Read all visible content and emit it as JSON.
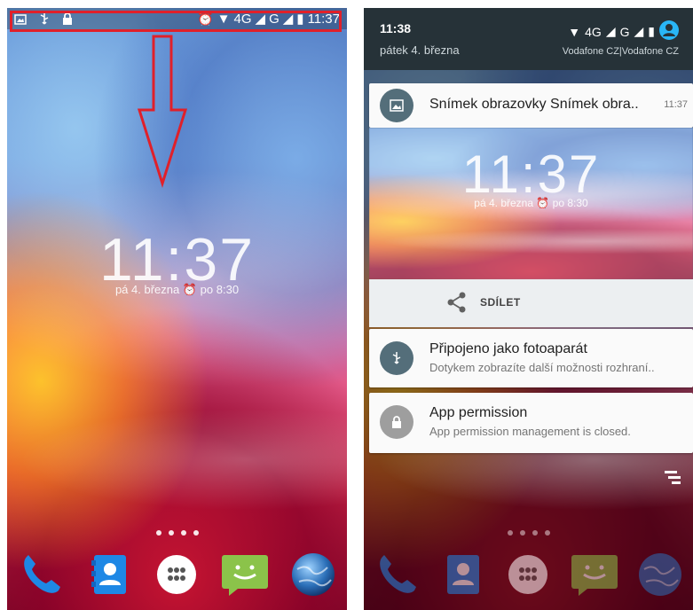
{
  "left": {
    "statusbar": {
      "time": "11:37",
      "network_1": "4G",
      "network_2": "G"
    },
    "lockscreen": {
      "clock": "11:37",
      "date": "pá 4. března",
      "alarm": "po 8:30"
    },
    "dock": [
      "phone-icon",
      "contacts-icon",
      "apps-icon",
      "messages-icon",
      "browser-icon"
    ]
  },
  "right": {
    "shade": {
      "time": "11:38",
      "date": "pátek 4. března",
      "network_1": "4G",
      "network_2": "G",
      "carrier": "Vodafone CZ|Vodafone CZ"
    },
    "notifications": [
      {
        "title": "Snímek obrazovky Snímek obra..",
        "time": "11:37"
      },
      {
        "title": "Připojeno jako fotoaparát",
        "text": "Dotykem zobrazíte další možnosti rozhraní.."
      },
      {
        "title": "App permission",
        "text": "App permission management is closed."
      }
    ],
    "preview": {
      "clock": "11:37",
      "date": "pá 4. března",
      "alarm": "po 8:30"
    },
    "share_label": "SDÍLET"
  },
  "colors": {
    "highlight": "#e0202a",
    "shade": "#263238",
    "notif_icon": "#546e7a"
  }
}
